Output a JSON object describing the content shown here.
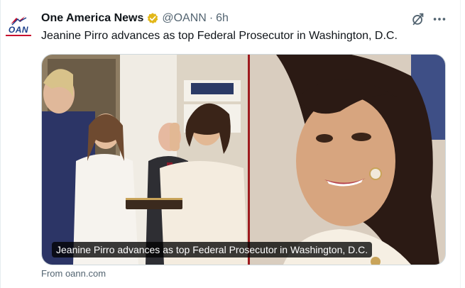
{
  "tweet": {
    "avatar_text": "OAN",
    "display_name": "One America News",
    "handle": "@OANN",
    "separator": "·",
    "time": "6h",
    "text": "Jeanine Pirro advances as top Federal Prosecutor in Washington, D.C.",
    "media_caption": "Jeanine Pirro advances as top Federal Prosecutor in Washington, D.C.",
    "source": "From oann.com",
    "icons": {
      "verified": "verified-badge-icon",
      "grok": "grok-icon",
      "more": "more-options-icon"
    },
    "colors": {
      "verified_gold": "#e2b719",
      "brand_blue": "#1b3e8a",
      "brand_red": "#c8102e",
      "muted_text": "#536471"
    }
  }
}
